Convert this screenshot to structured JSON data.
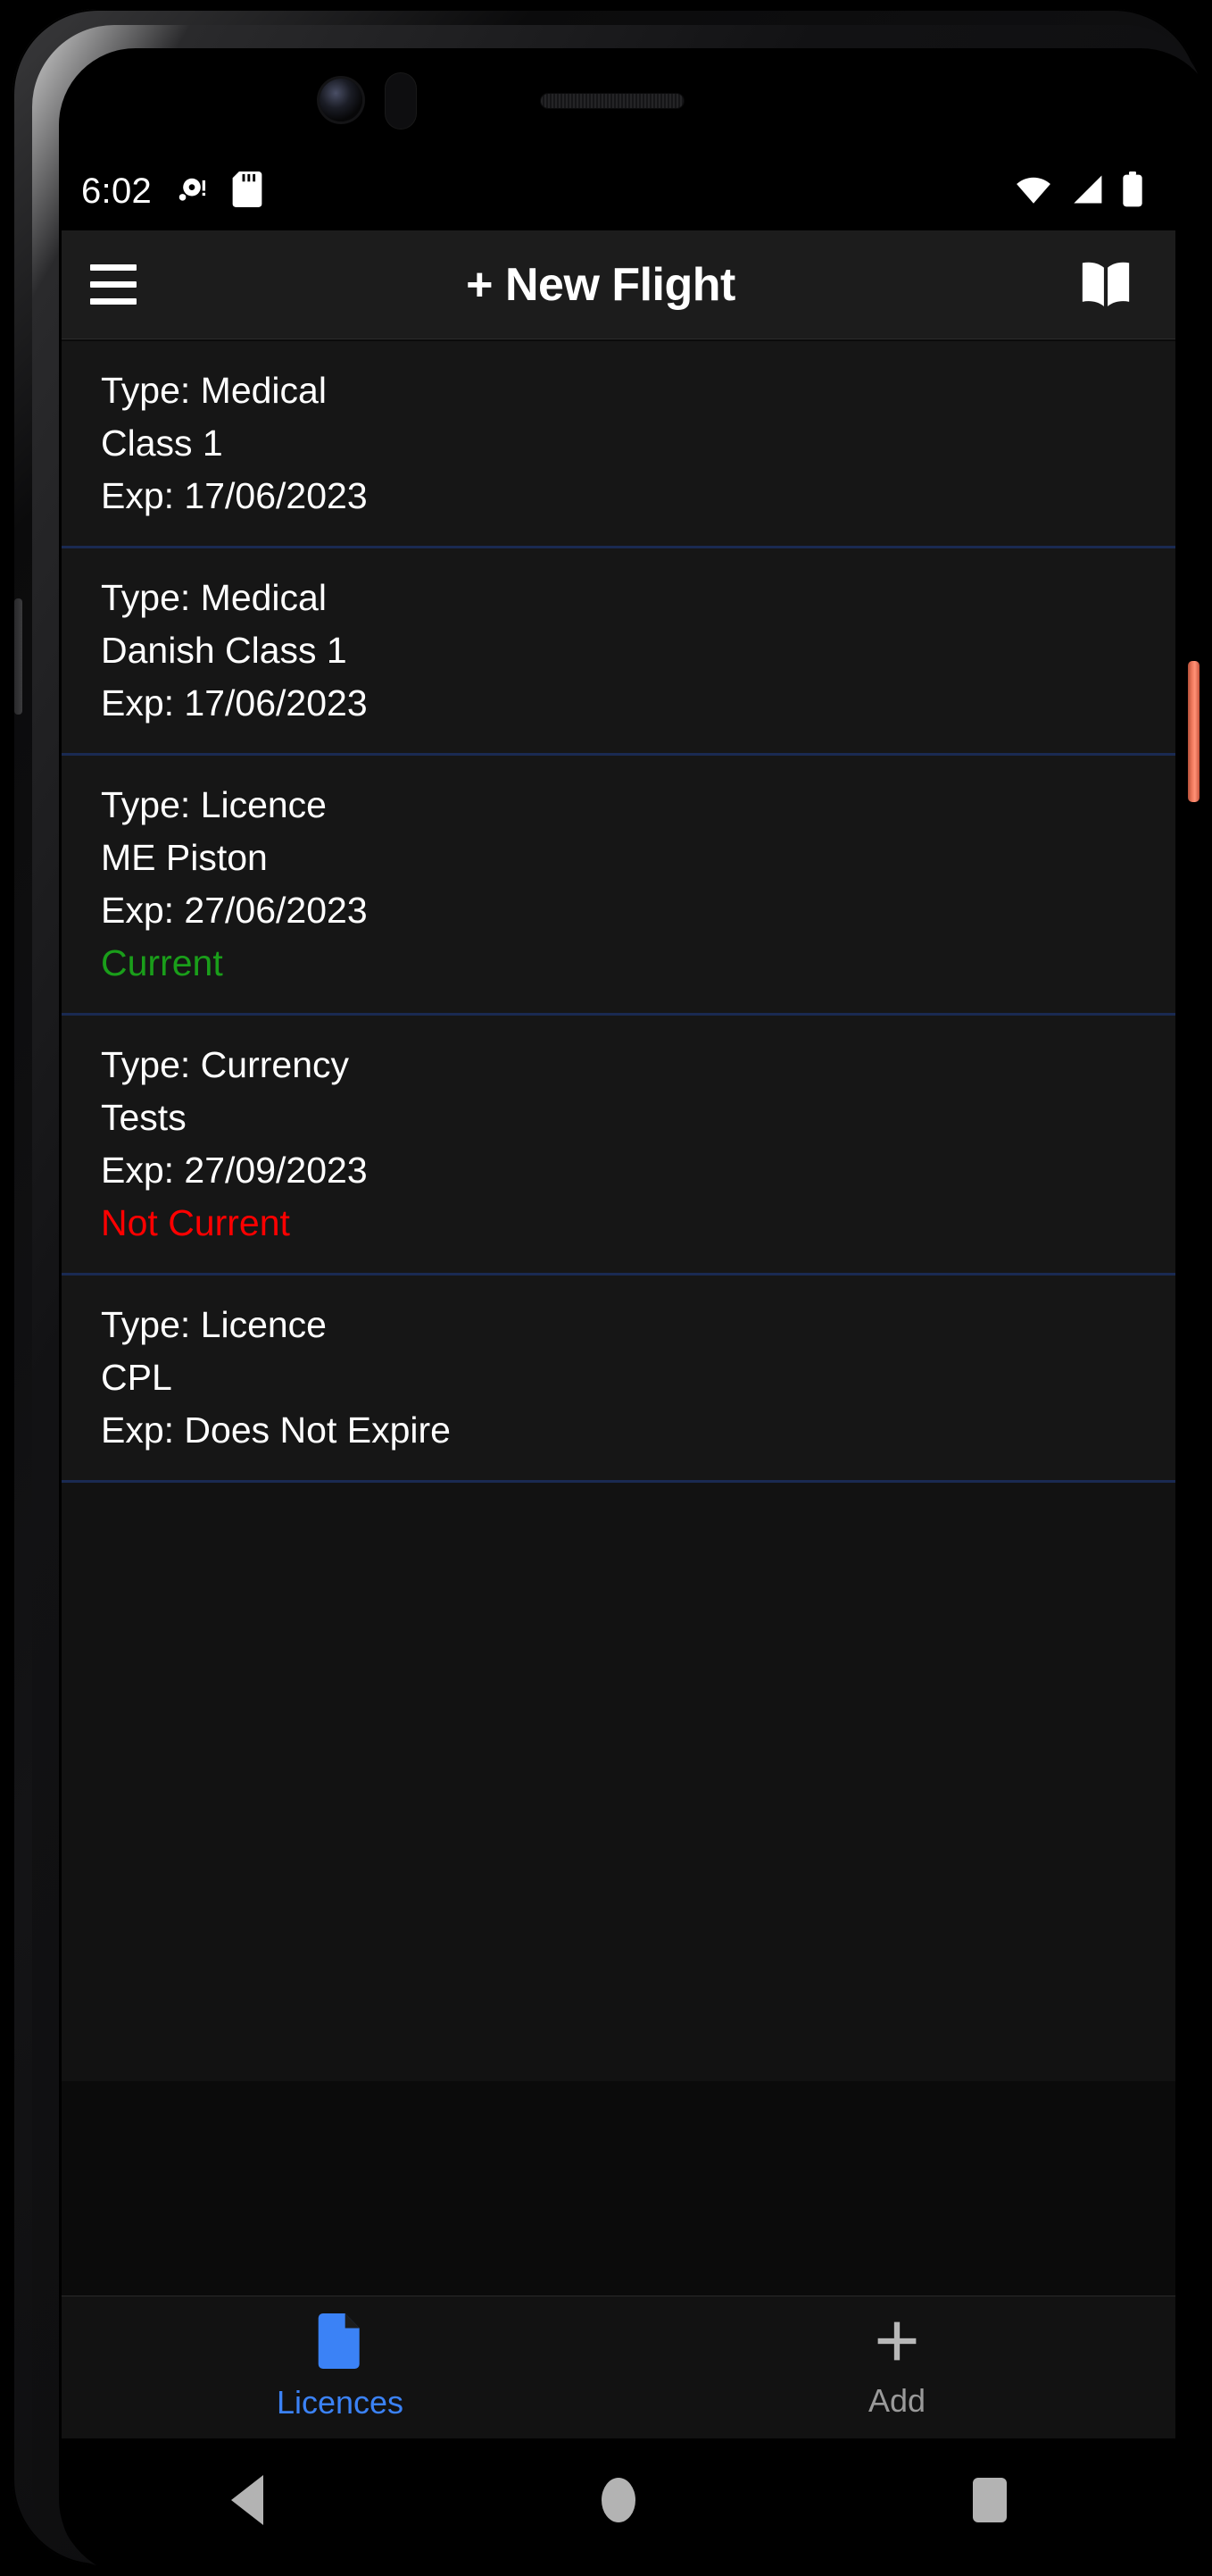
{
  "status_bar": {
    "clock": "6:02",
    "left_icons": [
      "notification-dot-icon",
      "sd-card-icon"
    ],
    "right_icons": [
      "wifi-icon",
      "cellular-signal-icon",
      "battery-icon"
    ]
  },
  "app_bar": {
    "menu_icon": "hamburger-menu-icon",
    "title": "+ New Flight",
    "action_icon": "open-book-icon"
  },
  "list": {
    "items": [
      {
        "type_line": "Type: Medical",
        "name_line": "Class 1",
        "expiry_line": "Exp: 17/06/2023",
        "status": "",
        "status_kind": "none"
      },
      {
        "type_line": "Type: Medical",
        "name_line": "Danish Class 1",
        "expiry_line": "Exp: 17/06/2023",
        "status": "",
        "status_kind": "none"
      },
      {
        "type_line": "Type: Licence",
        "name_line": "ME Piston",
        "expiry_line": "Exp: 27/06/2023",
        "status": "Current",
        "status_kind": "current"
      },
      {
        "type_line": "Type: Currency",
        "name_line": "Tests",
        "expiry_line": "Exp: 27/09/2023",
        "status": "Not Current",
        "status_kind": "not-current"
      },
      {
        "type_line": "Type: Licence",
        "name_line": "CPL",
        "expiry_line": "Exp: Does Not Expire",
        "status": "",
        "status_kind": "none"
      }
    ]
  },
  "bottom_nav": {
    "tabs": [
      {
        "label": "Licences",
        "icon": "document-icon",
        "active": true
      },
      {
        "label": "Add",
        "icon": "plus-icon",
        "active": false
      }
    ]
  },
  "android_nav": {
    "back": "back-triangle-icon",
    "home": "home-circle-icon",
    "recents": "recents-square-icon"
  },
  "colors": {
    "accent_blue": "#3b82f6",
    "status_current_green": "#1a9e1a",
    "status_not_current_red": "#fe0000",
    "divider_blue": "#1a2a52",
    "app_bar_bg": "#1c1c1c",
    "list_bg": "#161616",
    "power_button_coral": "#f0795c"
  }
}
